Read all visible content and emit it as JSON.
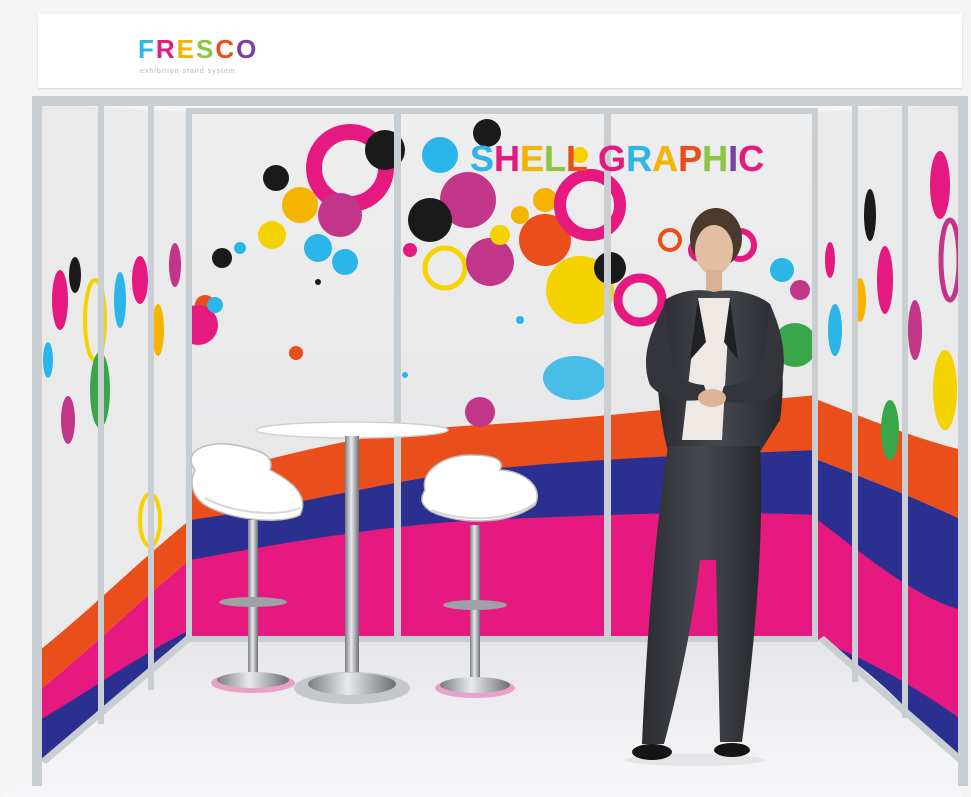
{
  "fascia": {
    "brand": "FRESCO",
    "brand_letter_colors": [
      "#2bb5e8",
      "#e5197f",
      "#f4b400",
      "#8cc63f",
      "#e94e1b",
      "#7b3fa0"
    ],
    "tagline": "exhibition stand system"
  },
  "back_wall": {
    "headline": "SHELL GRAPHIC",
    "headline_letter_colors": [
      "#2bb5e8",
      "#e5197f",
      "#f4b400",
      "#8cc63f",
      "#e94e1b",
      "#7b3fa0",
      "#e5197f",
      "#2bb5e8",
      "#f4b400",
      "#e94e1b",
      "#8cc63f",
      "#7b3fa0",
      "#e5197f"
    ]
  },
  "colors": {
    "magenta": "#e5197f",
    "orange": "#e94e1b",
    "navy": "#2b2f8f",
    "cyan": "#2bb5e8",
    "yellow": "#f4d300",
    "green": "#3aa64a",
    "frame": "#c9ced3",
    "floor": "#f1f1f3"
  },
  "furniture": [
    "white-bar-stool",
    "round-bar-table",
    "white-bar-stool"
  ],
  "figure": "woman-in-dark-suit"
}
